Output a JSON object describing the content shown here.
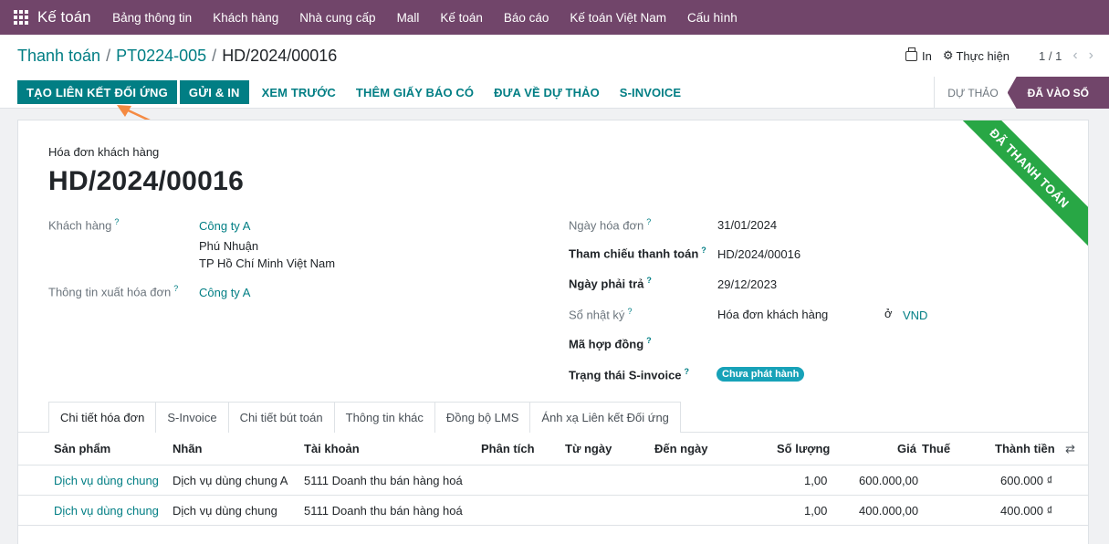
{
  "topnav": {
    "app_name": "Kế toán",
    "items": [
      "Bảng thông tin",
      "Khách hàng",
      "Nhà cung cấp",
      "Mall",
      "Kế toán",
      "Báo cáo",
      "Kế toán Việt Nam",
      "Cấu hình"
    ]
  },
  "breadcrumb": [
    "Thanh toán",
    "PT0224-005",
    "HD/2024/00016"
  ],
  "control": {
    "print_label": "In",
    "action_label": "Thực hiện",
    "pager": "1 / 1"
  },
  "actions": {
    "primary": [
      "TẠO LIÊN KẾT ĐỐI ỨNG",
      "GỬI & IN"
    ],
    "links": [
      "XEM TRƯỚC",
      "THÊM GIẤY BÁO CÓ",
      "ĐƯA VỀ DỰ THẢO",
      "S-INVOICE"
    ]
  },
  "statusbar": {
    "draft": "DỰ THẢO",
    "posted": "ĐÃ VÀO SỔ"
  },
  "ribbon": "ĐÃ THANH TOÁN",
  "document": {
    "type_label": "Hóa đơn khách hàng",
    "number": "HD/2024/00016"
  },
  "left_fields": {
    "customer_label": "Khách hàng",
    "customer_name": "Công ty A",
    "customer_addr1": "Phú Nhuận",
    "customer_addr2": "TP Hồ Chí Minh Việt Nam",
    "invoice_info_label": "Thông tin xuất hóa đơn",
    "invoice_info_value": "Công ty A"
  },
  "right_fields": {
    "invoice_date_label": "Ngày hóa đơn",
    "invoice_date": "31/01/2024",
    "payment_ref_label": "Tham chiếu thanh toán",
    "payment_ref": "HD/2024/00016",
    "due_date_label": "Ngày phải trả",
    "due_date": "29/12/2023",
    "journal_label": "Sổ nhật ký",
    "journal": "Hóa đơn khách hàng",
    "journal_in": "ở",
    "currency": "VND",
    "contract_label": "Mã hợp đồng",
    "sinvoice_status_label": "Trạng thái S-invoice",
    "sinvoice_status": "Chưa phát hành"
  },
  "tabs": [
    "Chi tiết hóa đơn",
    "S-Invoice",
    "Chi tiết bút toán",
    "Thông tin khác",
    "Đồng bộ LMS",
    "Ánh xạ Liên kết Đối ứng"
  ],
  "table": {
    "headers": [
      "Sản phẩm",
      "Nhãn",
      "Tài khoản",
      "Phân tích",
      "Từ ngày",
      "Đến ngày",
      "Số lượng",
      "Giá",
      "Thuế",
      "Thành tiền"
    ],
    "rows": [
      {
        "product": "Dịch vụ dùng chung",
        "label": "Dịch vụ dùng chung A",
        "account": "5111 Doanh thu bán hàng hoá",
        "qty": "1,00",
        "price": "600.000,00",
        "subtotal": "600.000 ₫"
      },
      {
        "product": "Dịch vụ dùng chung",
        "label": "Dịch vụ dùng chung",
        "account": "5111 Doanh thu bán hàng hoá",
        "qty": "1,00",
        "price": "400.000,00",
        "subtotal": "400.000 ₫"
      }
    ]
  },
  "colors": {
    "brand": "#71456a",
    "primary": "#017e84",
    "ribbon": "#28a745",
    "badge": "#17a2b8",
    "arrow": "#f58a42"
  }
}
